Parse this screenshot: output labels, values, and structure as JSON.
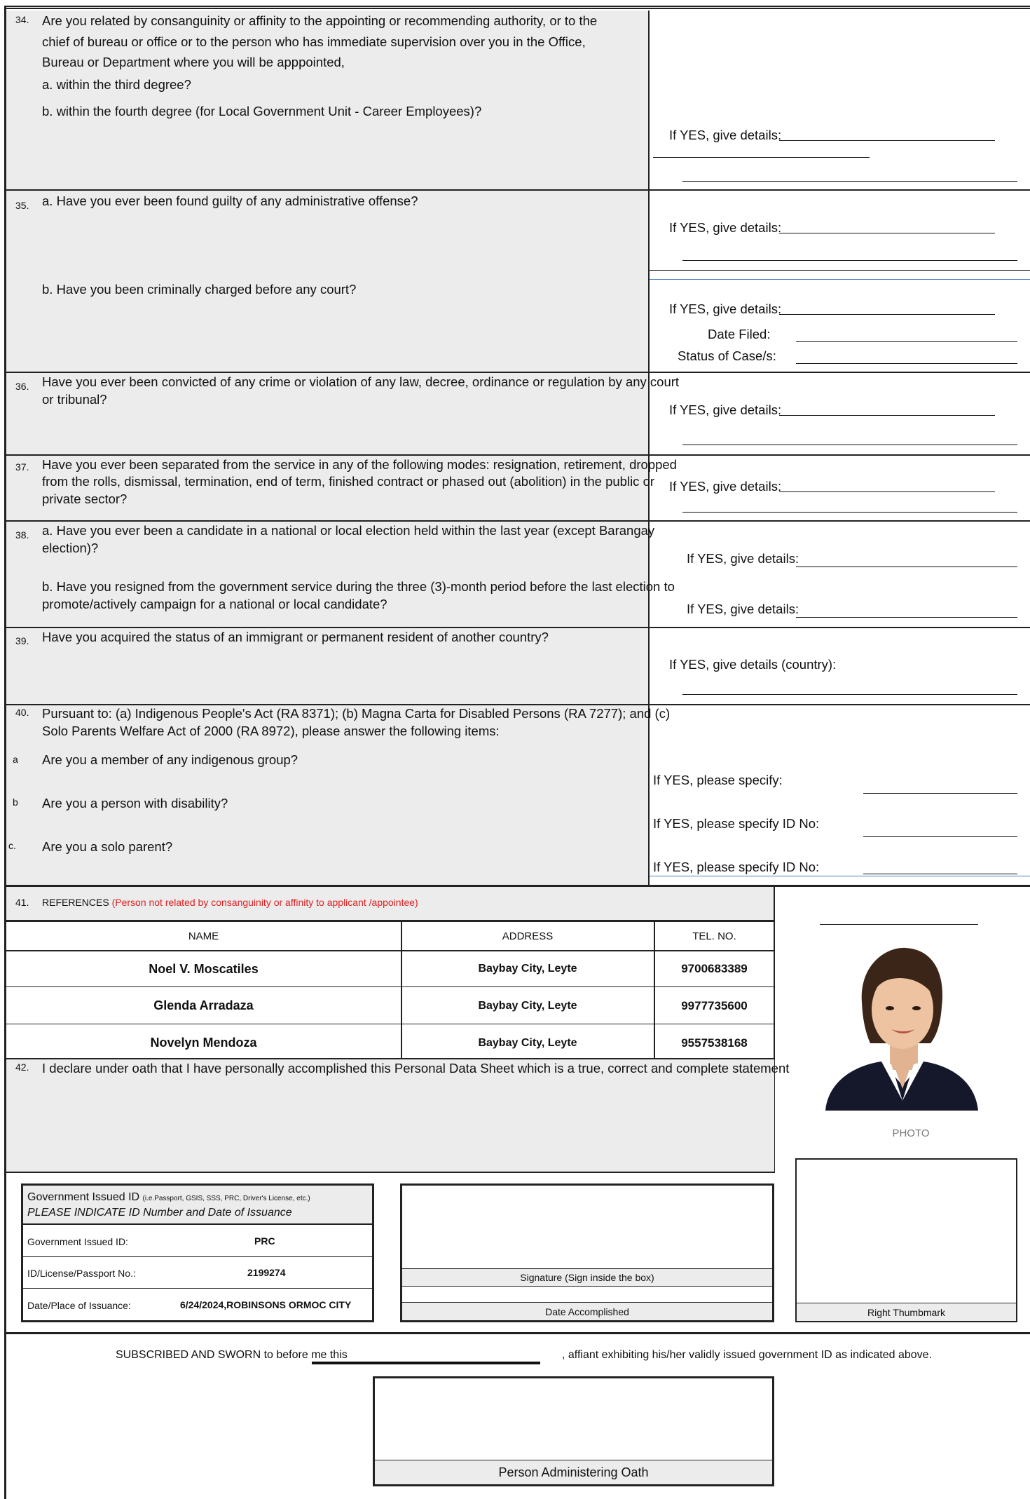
{
  "questions": {
    "q34": {
      "num": "34.",
      "line1": "Are you related by consanguinity or affinity to the appointing or recommending authority, or to the",
      "line2": "chief of bureau or office or to the person who has immediate supervision over you in the Office,",
      "line3": "Bureau or Department where you will be apppointed,",
      "a": "a. within the third degree?",
      "b": "b. within the fourth degree (for Local Government Unit - Career Employees)?",
      "details": "If YES, give details:"
    },
    "q35": {
      "num": "35.",
      "a": "a. Have you ever been found guilty of any administrative offense?",
      "b": "b. Have you been criminally charged before any court?",
      "details_a": "If YES, give details:",
      "details_b": "If YES, give details:",
      "date_filed": "Date Filed:",
      "status": "Status of Case/s:"
    },
    "q36": {
      "num": "36.",
      "line1": "Have you ever been convicted of any crime or violation of any law, decree, ordinance or regulation by any court",
      "line2": "or tribunal?",
      "details": "If YES, give details:"
    },
    "q37": {
      "num": "37.",
      "line1": "Have you ever been separated from the service in any of the following modes: resignation, retirement, dropped",
      "line2": "from the rolls, dismissal, termination, end of term, finished contract or phased out (abolition) in the public or",
      "line3": "private sector?",
      "details": "If YES, give details:"
    },
    "q38": {
      "num": "38.",
      "a1": "a. Have you ever been a candidate in a national or local election held within the last year (except Barangay",
      "a2": "election)?",
      "b1": "b. Have you resigned from the government service during the three (3)-month period before the last election to",
      "b2": "promote/actively campaign for a national or local candidate?",
      "details_a": "If YES, give details:",
      "details_b": "If YES, give details:"
    },
    "q39": {
      "num": "39.",
      "line1": "Have you acquired the status of an immigrant or permanent resident of another country?",
      "details": "If YES, give details (country):"
    },
    "q40": {
      "num": "40.",
      "line1": "Pursuant to: (a) Indigenous People's Act (RA 8371); (b) Magna Carta for Disabled Persons (RA 7277); and (c)",
      "line2": "Solo Parents Welfare Act of 2000 (RA 8972), please answer the following items:",
      "a_letter": "a",
      "a": "Are you a member of any indigenous group?",
      "b_letter": "b",
      "b": "Are you a person with disability?",
      "c_letter": "c.",
      "c": "Are you a solo parent?",
      "spec_a": "If YES, please specify:",
      "spec_b": "If YES, please specify ID No:",
      "spec_c": "If YES, please specify ID No:"
    }
  },
  "references": {
    "num": "41.",
    "title": "REFERENCES",
    "note": "(Person not related by consanguinity or affinity to applicant /appointee)",
    "headers": {
      "name": "NAME",
      "address": "ADDRESS",
      "tel": "TEL. NO."
    },
    "rows": [
      {
        "name": "Noel V. Moscatiles",
        "address": "Baybay City, Leyte",
        "tel": "9700683389"
      },
      {
        "name": "Glenda Arradaza",
        "address": "Baybay City, Leyte",
        "tel": "9977735600"
      },
      {
        "name": "Novelyn Mendoza",
        "address": "Baybay City, Leyte",
        "tel": "9557538168"
      }
    ]
  },
  "declaration": {
    "num": "42.",
    "text": "I declare under oath that I have personally accomplished this Personal Data Sheet which is a true, correct and complete statement"
  },
  "photo": {
    "label": "PHOTO"
  },
  "gov_id": {
    "title": "Government Issued ID",
    "title_small": "(i.e.Passport, GSIS, SSS, PRC, Driver's License, etc.)",
    "subtitle": "PLEASE INDICATE ID Number and Date of Issuance",
    "id_label": "Government Issued ID:",
    "id_value": "PRC",
    "no_label": "ID/License/Passport No.:",
    "no_value": "2199274",
    "date_label": "Date/Place of Issuance:",
    "date_value": "6/24/2024,ROBINSONS ORMOC CITY"
  },
  "signature": {
    "label": "Signature (Sign inside the box)",
    "date_label": "Date Accomplished"
  },
  "thumbmark": {
    "label": "Right Thumbmark"
  },
  "oath": {
    "text_before": "SUBSCRIBED AND SWORN to before me this",
    "text_after": ", affiant exhibiting his/her validly issued government ID as indicated above.",
    "box_label": "Person Administering Oath"
  }
}
